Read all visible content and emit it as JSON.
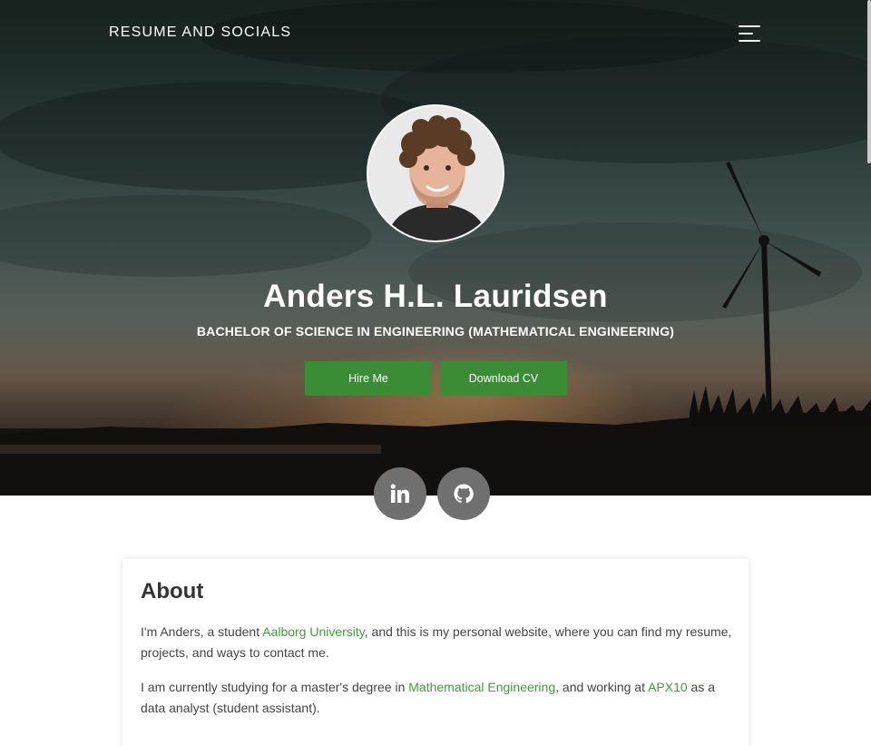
{
  "nav": {
    "brand": "RESUME AND SOCIALS",
    "menu_icon": "hamburger-menu-icon"
  },
  "hero": {
    "avatar_icon": "profile-photo",
    "name": "Anders H.L. Lauridsen",
    "degree": "BACHELOR OF SCIENCE IN ENGINEERING (MATHEMATICAL ENGINEERING)",
    "hire_button": "Hire Me",
    "cv_button": "Download CV"
  },
  "social": {
    "linkedin_icon": "linkedin-icon",
    "github_icon": "github-icon"
  },
  "about": {
    "title": "About",
    "p1_before": "I'm Anders, a student ",
    "p1_link": "Aalborg University",
    "p1_after": ", and this is my personal website, where you can find my resume, projects, and ways to contact me.",
    "p2_before": "I am currently studying for a master's degree in ",
    "p2_link1": "Mathematical Engineering",
    "p2_middle": ", and working at ",
    "p2_link2": "APX10",
    "p2_after": " as a data analyst (student assistant)."
  },
  "colors": {
    "accent_green": "#3a8d34",
    "link_green": "#3f9d38",
    "social_gray": "#707070"
  }
}
